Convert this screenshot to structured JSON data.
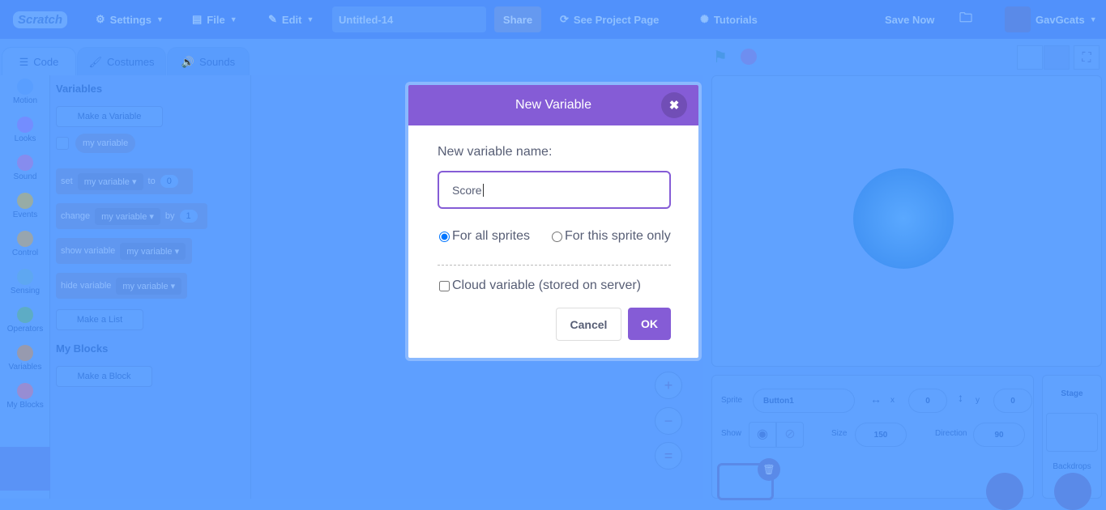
{
  "menubar": {
    "logo": "Scratch",
    "settings": "Settings",
    "file": "File",
    "edit": "Edit",
    "project_title": "Untitled-14",
    "share": "Share",
    "see_project_page": "See Project Page",
    "tutorials": "Tutorials",
    "save_now": "Save Now",
    "username": "GavGcats"
  },
  "tabs": [
    {
      "label": "Code"
    },
    {
      "label": "Costumes"
    },
    {
      "label": "Sounds"
    }
  ],
  "categories": [
    {
      "label": "Motion",
      "color": "#4c97ff"
    },
    {
      "label": "Looks",
      "color": "#9966ff"
    },
    {
      "label": "Sound",
      "color": "#cf63cf"
    },
    {
      "label": "Events",
      "color": "#ffbf00"
    },
    {
      "label": "Control",
      "color": "#ffab19"
    },
    {
      "label": "Sensing",
      "color": "#5cb1d6"
    },
    {
      "label": "Operators",
      "color": "#59c059"
    },
    {
      "label": "Variables",
      "color": "#ff8c1a"
    },
    {
      "label": "My Blocks",
      "color": "#ff6680"
    }
  ],
  "palette": {
    "variables_heading": "Variables",
    "make_variable": "Make a Variable",
    "my_variable": "my variable",
    "set_block": {
      "label": "set",
      "var": "my variable",
      "to": "to",
      "value": "0"
    },
    "change_block": {
      "label": "change",
      "var": "my variable",
      "by": "by",
      "value": "1"
    },
    "show_block": {
      "label": "show variable",
      "var": "my variable"
    },
    "hide_block": {
      "label": "hide variable",
      "var": "my variable"
    },
    "make_list": "Make a List",
    "my_blocks_heading": "My Blocks",
    "make_block": "Make a Block"
  },
  "sprite_info": {
    "sprite_label": "Sprite",
    "sprite_name": "Button1",
    "x_label": "x",
    "x": "0",
    "y_label": "y",
    "y": "0",
    "show_label": "Show",
    "size_label": "Size",
    "size": "150",
    "direction_label": "Direction",
    "direction": "90"
  },
  "stage_panel": {
    "stage_label": "Stage",
    "backdrops_label": "Backdrops"
  },
  "modal": {
    "title": "New Variable",
    "name_label": "New variable name:",
    "name_value": "Score",
    "radio_all": "For all sprites",
    "radio_this": "For this sprite only",
    "selected_scope": "For all sprites",
    "cloud_label": "Cloud variable (stored on server)",
    "cloud_checked": false,
    "cancel": "Cancel",
    "ok": "OK",
    "accent": "#855cd6"
  }
}
